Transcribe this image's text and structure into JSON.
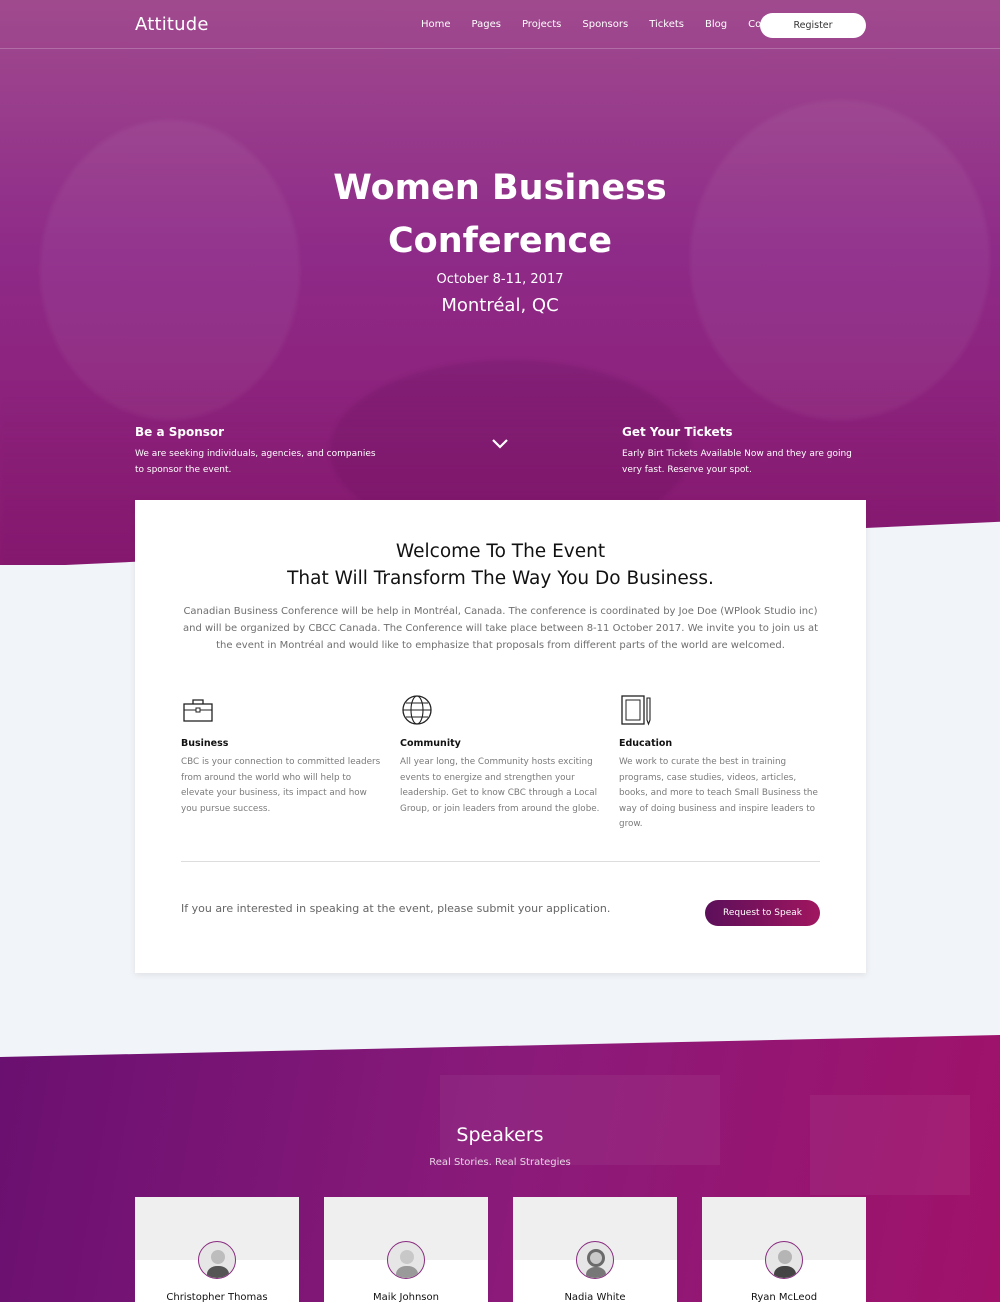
{
  "nav": {
    "logo": "Attitude",
    "menu": [
      "Home",
      "Pages",
      "Projects",
      "Sponsors",
      "Tickets",
      "Blog",
      "Contact"
    ],
    "register": "Register"
  },
  "hero": {
    "title_line1": "Women Business",
    "title_line2": "Conference",
    "date": "October 8-11, 2017",
    "place": "Montréal, QC",
    "sponsor_title": "Be a Sponsor",
    "sponsor_text": "We are seeking individuals, agencies, and companies to sponsor the event.",
    "tickets_title": "Get Your Tickets",
    "tickets_text": "Early Birt Tickets Available Now and they are going very fast. Reserve your spot."
  },
  "welcome": {
    "title_line1": "Welcome To The Event",
    "title_line2": "That Will Transform The Way You Do Business.",
    "intro": "Canadian Business Conference will be help in Montréal, Canada. The conference is coordinated by Joe Doe (WPlook Studio inc) and will be organized by CBCC Canada. The Conference will take place between 8-11 October 2017. We invite you to join us at the event in Montréal and would like to emphasize that proposals from different parts of the world are welcomed.",
    "features": [
      {
        "title": "Business",
        "text": "CBC is your connection to committed leaders from around the world who will help to elevate your business, its impact and how you pursue success.",
        "icon": "briefcase-icon"
      },
      {
        "title": "Community",
        "text": "All year long, the Community hosts exciting events to energize and strengthen your leadership. Get to know CBC through a Local Group, or join leaders from around the globe.",
        "icon": "globe-icon"
      },
      {
        "title": "Education",
        "text": "We work to curate the best in training programs, case studies, videos, articles, books, and more to teach Small Business the way of doing business and inspire leaders to grow.",
        "icon": "notebook-icon"
      }
    ],
    "speak_text": "If you are interested in speaking at the event, please submit your application.",
    "speak_button": "Request to Speak"
  },
  "speakers": {
    "title": "Speakers",
    "subtitle": "Real Stories. Real Strategies",
    "list": [
      "Christopher Thomas",
      "Maik Johnson",
      "Nadia White",
      "Ryan McLeod"
    ]
  },
  "colors": {
    "accent": "#8e1a7a",
    "button_gradient_start": "#5c0f5a",
    "button_gradient_end": "#a0165f"
  }
}
